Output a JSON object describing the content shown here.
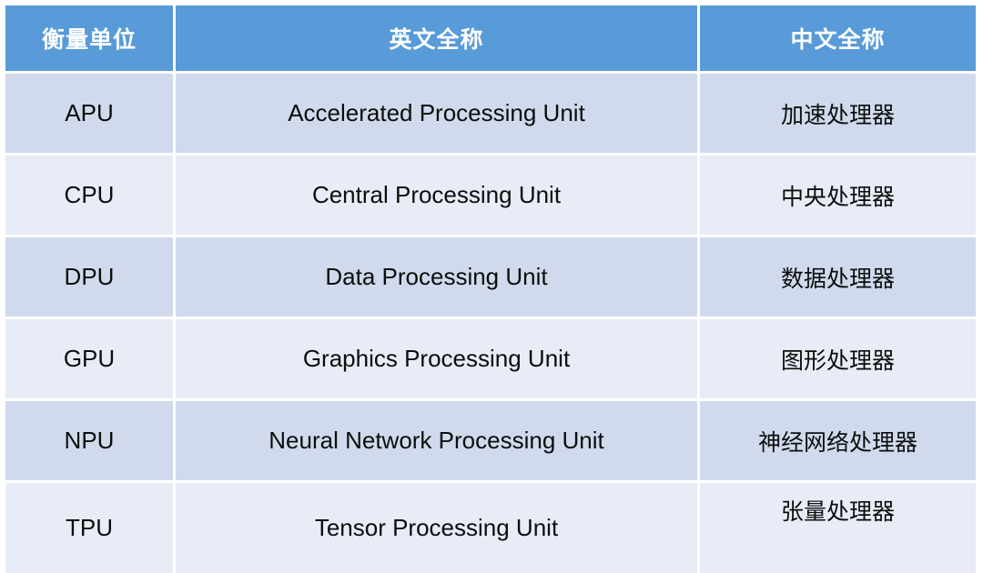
{
  "table": {
    "headers": {
      "unit": "衡量单位",
      "english": "英文全称",
      "chinese": "中文全称"
    },
    "rows": [
      {
        "unit": "APU",
        "english": "Accelerated Processing Unit",
        "chinese": "加速处理器"
      },
      {
        "unit": "CPU",
        "english": "Central Processing Unit",
        "chinese": "中央处理器"
      },
      {
        "unit": "DPU",
        "english": "Data Processing Unit",
        "chinese": "数据处理器"
      },
      {
        "unit": "GPU",
        "english": "Graphics Processing Unit",
        "chinese": "图形处理器"
      },
      {
        "unit": "NPU",
        "english": "Neural Network Processing Unit",
        "chinese": "神经网络处理器"
      },
      {
        "unit": "TPU",
        "english": "Tensor Processing Unit",
        "chinese": "张量处理器"
      }
    ]
  },
  "colors": {
    "header_background": "#589BD8",
    "header_text": "#FFFFFF",
    "row_shade_dark": "#D0DAEC",
    "row_shade_light": "#E7ECF6",
    "gridline": "#FFFFFF",
    "body_text": "#0D0D0D",
    "page_background": "#FFFFFF"
  }
}
